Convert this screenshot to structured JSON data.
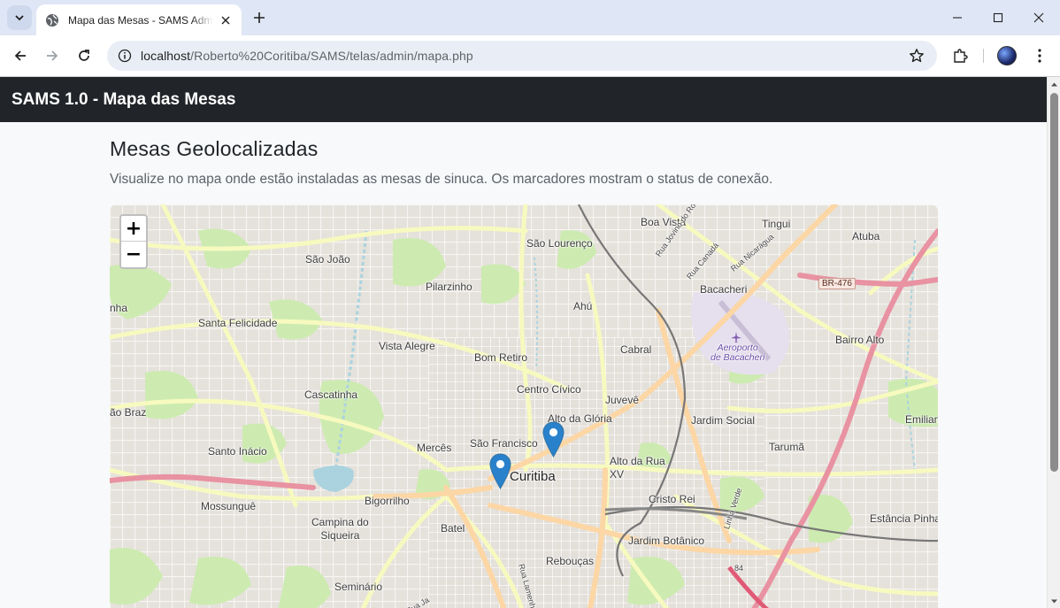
{
  "browser": {
    "tab_title": "Mapa das Mesas - SAMS Admin",
    "url_host": "localhost",
    "url_path": "/Roberto%20Coritiba/SAMS/telas/admin/mapa.php"
  },
  "navbar": {
    "brand": "SAMS 1.0 - Mapa das Mesas"
  },
  "page": {
    "heading": "Mesas Geolocalizadas",
    "lead": "Visualize no mapa onde estão instaladas as mesas de sinuca. Os marcadores mostram o status de conexão."
  },
  "map": {
    "zoom_in": "+",
    "zoom_out": "−",
    "labels": {
      "boa_vista": "Boa Vista",
      "tingui": "Tingui",
      "atuba": "Atuba",
      "sao_lourenco": "São Lourenço",
      "sao_joao": "São João",
      "pilarzinho": "Pilarzinho",
      "bacacheri": "Bacacheri",
      "br476": "BR-476",
      "ahu": "Ahú",
      "santa_felicidade": "Santa Felicidade",
      "nha": "nha",
      "vista_alegre": "Vista Alegre",
      "bom_retiro": "Bom Retiro",
      "cabral": "Cabral",
      "aeroporto": "Aeroporto\nde Bacacheri",
      "bairro_alto": "Bairro Alto",
      "cascatinha": "Cascatinha",
      "centro_civico": "Centro Cívico",
      "juveve": "Juvevê",
      "sao_braz": "ão Braz",
      "alto_da_gloria": "Alto da Glória",
      "jardim_social": "Jardim Social",
      "emiliano": "Emilian",
      "santo_inacio": "Santo Inácio",
      "merces": "Mercês",
      "sao_francisco": "São Francisco",
      "alto_da_rua_xv": "Alto da Rua\nXV",
      "taruma": "Tarumã",
      "curitiba": "Curitiba",
      "mossungue": "Mossunguê",
      "bigorrilho": "Bigorrilho",
      "cristo_rei": "Cristo Rei",
      "campina": "Campina do\nSiqueira",
      "batel": "Batel",
      "jardim_botanico": "Jardim Botânico",
      "estancia": "Estância Pinha",
      "reboucas": "Rebouças",
      "seminario": "Seminário",
      "rua_joao_gualberto": "Rua Jovino do Rosário",
      "rua_canada": "Rua Canadá",
      "rua_nicaragua": "Rua Nicarágua",
      "linha_verde": "Linha Verde",
      "rua_lamenha": "Rua Lamenha",
      "rua_ja": "Rua Ja",
      "route_84": "84"
    }
  },
  "colors": {
    "navbar": "#212529",
    "marker": "#2a81cb",
    "map_bg": "#f2efe9",
    "major_road": "#f7fabf",
    "primary_road": "#fcd6a4",
    "motorway": "#e892a2",
    "park": "#cdebb0",
    "water": "#aad3df"
  },
  "icons": [
    "tab-list-icon",
    "globe-icon",
    "close-icon",
    "plus-icon",
    "minimize-icon",
    "maximize-icon",
    "window-close-icon",
    "back-icon",
    "forward-icon",
    "reload-icon",
    "info-icon",
    "star-icon",
    "extensions-icon",
    "kebab-menu-icon",
    "map-marker-icon",
    "airport-icon"
  ]
}
